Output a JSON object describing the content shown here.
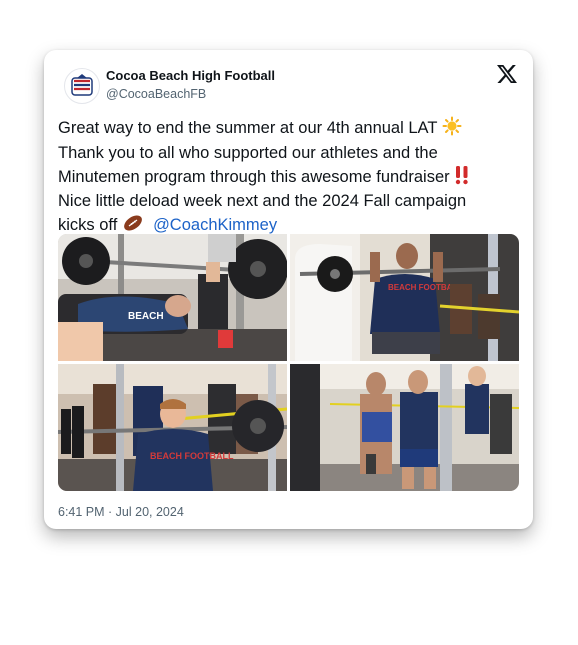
{
  "post": {
    "author_name": "Cocoa Beach High Football",
    "author_handle": "@CocoaBeachFB",
    "lines": [
      "Great way to end the summer at our 4th annual LAT",
      "Thank you to all who supported our athletes and the",
      "Minutemen program through this awesome fundraiser",
      "Nice little deload week next and the 2024 Fall campaign",
      "kicks off"
    ],
    "mention": "@CoachKimmey",
    "timestamp": "6:41 PM · Jul 20, 2024"
  },
  "photos": [
    {
      "shirt_text": "BEACH"
    },
    {
      "shirt_text": "BEACH FOOTBALL"
    },
    {
      "shirt_text": "BEACH FOOTBALL"
    },
    {
      "shirt_text": ""
    }
  ],
  "icons": {
    "logo": "x-logo-icon",
    "avatar": "cocoa-beach-minuteman-logo",
    "emoji": [
      "sun-emoji",
      "double-exclamation-emoji",
      "football-emoji"
    ]
  },
  "colors": {
    "text": "#0f1419",
    "secondary": "#536471",
    "mention": "#1d63c8",
    "shirt_navy": "#22345f",
    "shirt_red": "#c0262d"
  }
}
